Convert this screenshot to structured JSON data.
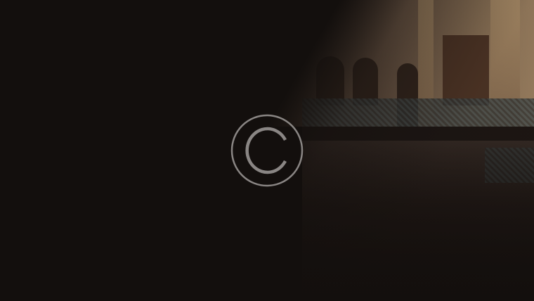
{
  "hero": {
    "overlay_icon": "copyright-icon",
    "colors": {
      "background": "#130f0d",
      "icon_stroke": "#8a8684"
    }
  }
}
